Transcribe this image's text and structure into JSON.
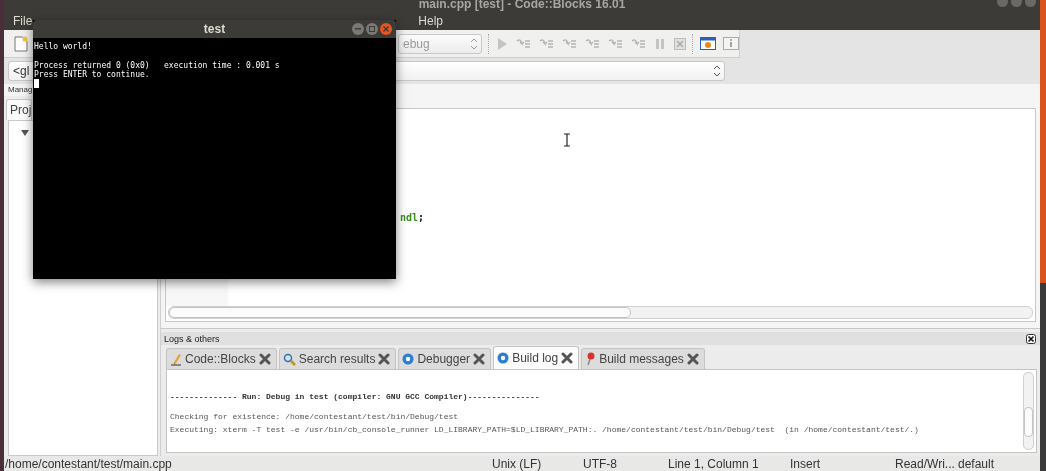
{
  "window": {
    "title": "main.cpp [test] - Code::Blocks 16.01"
  },
  "menu": [
    "File",
    "Help"
  ],
  "toolbar": {
    "build_target": "ebug"
  },
  "scope_selector": {
    "value": "<gl"
  },
  "management": {
    "title": "Manag",
    "tabs": [
      {
        "label": "Proj",
        "selected": true
      }
    ],
    "tree": [
      {
        "expanded": true
      }
    ]
  },
  "editor": {
    "code": [
      {
        "text": "ndl",
        "kind": "keyword"
      },
      {
        "text": ";",
        "kind": "plain"
      }
    ]
  },
  "logs": {
    "title": "Logs & others",
    "tabs": [
      {
        "label": "Code::Blocks",
        "kind": "pencil",
        "selected": false
      },
      {
        "label": "Search results",
        "kind": "search",
        "selected": false
      },
      {
        "label": "Debugger",
        "kind": "debugger",
        "selected": false
      },
      {
        "label": "Build log",
        "kind": "build",
        "selected": true
      },
      {
        "label": "Build messages",
        "kind": "pin",
        "selected": false
      }
    ],
    "paragraphs": [
      [
        {
          "text": "-------------- Run: Debug in test (compiler: GNU GCC Compiler)---------------",
          "bold": true
        }
      ],
      [
        {
          "text": "Checking for existence: /home/contestant/test/bin/Debug/test",
          "bold": false
        },
        {
          "text": "Executing: xterm -T test -e /usr/bin/cb_console_runner LD_LIBRARY_PATH=$LD_LIBRARY_PATH:. /home/contestant/test/bin/Debug/test  (in /home/contestant/test/.)",
          "bold": false
        }
      ]
    ]
  },
  "status_bar": [
    "/home/contestant/test/main.cpp",
    "Unix (LF)",
    "UTF-8",
    "Line 1, Column 1",
    "Insert",
    "Read/Wri...",
    "default"
  ],
  "terminal": {
    "title": "test",
    "paragraphs": [
      [
        "Hello world!"
      ],
      [
        "Process returned 0 (0x0)   execution time : 0.001 s",
        "Press ENTER to continue."
      ]
    ]
  }
}
